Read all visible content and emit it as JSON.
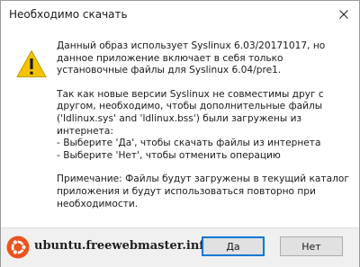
{
  "window": {
    "title": "Необходимо скачать"
  },
  "message": {
    "paragraphs": [
      "Данный образ использует Syslinux 6.03/20171017, но\nданное приложение включает в себя только\nустановочные файлы для Syslinux 6.04/pre1.",
      "Так как новые версии Syslinux не совместимы друг с\nдругом, необходимо, чтобы дополнительные файлы\n('ldlinux.sys' and 'ldlinux.bss') были загружены из\nинтернета:\n- Выберите 'Да', чтобы скачать файлы из интернета\n- Выберите 'Нет', чтобы отменить операцию",
      "Примечание: Файлы будут загружены в текущий каталог\nприложения и будут использоваться повторно при\nнеобходимости."
    ]
  },
  "footer": {
    "watermark": "ubuntu.freewebmaster.info",
    "yes_label": "Да",
    "no_label": "Нет"
  },
  "colors": {
    "accent": "#0078d7",
    "warning": "#f5c400",
    "ubuntu_logo": "#e95420"
  },
  "icons": {
    "message": "warning-icon",
    "close": "close-icon",
    "logo": "ubuntu-logo-icon"
  }
}
